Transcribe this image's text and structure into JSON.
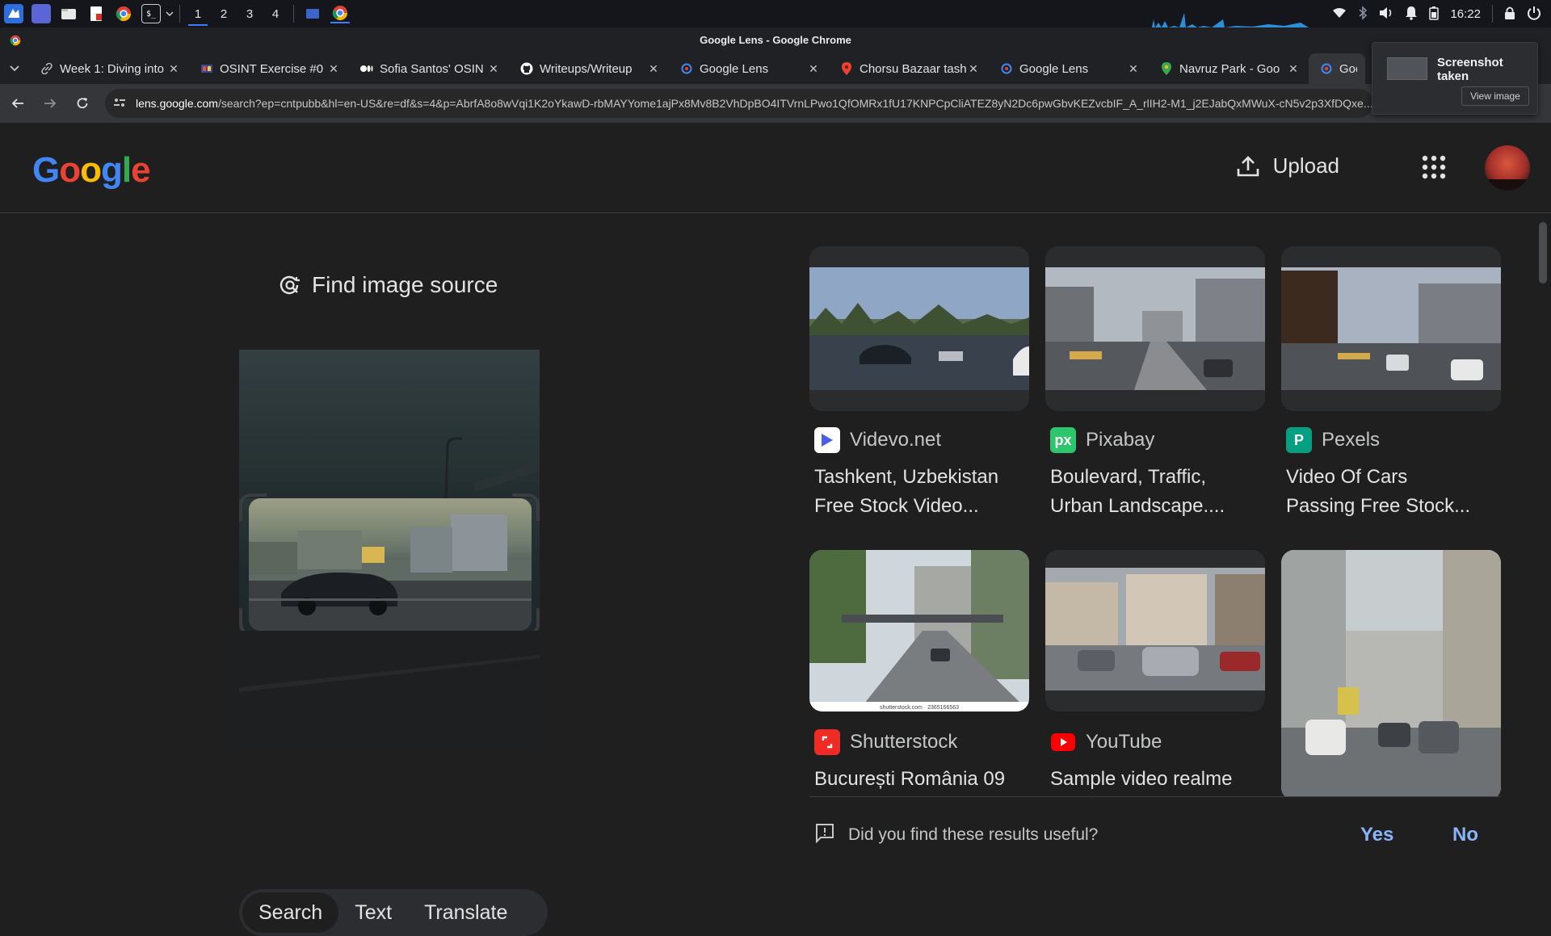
{
  "taskbar": {
    "workspaces": [
      "1",
      "2",
      "3",
      "4"
    ],
    "clock": "16:22"
  },
  "window": {
    "title": "Google Lens - Google Chrome"
  },
  "tabs": [
    {
      "label": "Week 1: Diving into",
      "icon": "link-icon"
    },
    {
      "label": "OSINT Exercise #0",
      "icon": "osint-favicon"
    },
    {
      "label": "Sofia Santos' OSIN",
      "icon": "medium-favicon"
    },
    {
      "label": "Writeups/Writeup",
      "icon": "github-favicon"
    },
    {
      "label": "Google Lens",
      "icon": "lens-favicon"
    },
    {
      "label": "Chorsu Bazaar tash",
      "icon": "maps-pin-favicon"
    },
    {
      "label": "Google Lens",
      "icon": "lens-favicon"
    },
    {
      "label": "Navruz Park - Goo",
      "icon": "maps-pin-favicon"
    },
    {
      "label": "Goog",
      "icon": "lens-favicon",
      "active": true
    }
  ],
  "address_bar": {
    "host": "lens.google.com",
    "path": "/search?ep=cntpubb&hl=en-US&re=df&s=4&p=AbrfA8o8wVqi1K2oYkawD-rbMAYYome1ajPx8Mv8B2VhDpBO4ITVrnLPwo1QfOMRx1fU17KNPCpCliATEZ8yN2Dc6pwGbvKEZvcbIF_A_rlIH2-M1_j2EJabQxMWuX-cN5v2p3XfDQxe..."
  },
  "notification": {
    "title": "Screenshot taken",
    "button": "View image"
  },
  "header": {
    "logo": "Google",
    "upload_label": "Upload"
  },
  "lens": {
    "find_source_label": "Find image source",
    "modes": [
      "Search",
      "Text",
      "Translate"
    ],
    "active_mode": "Search"
  },
  "results": [
    {
      "source": "Videvo.net",
      "title_line1": "Tashkent, Uzbekistan",
      "title_line2": "Free Stock Video...",
      "source_color": "#4c5ee8"
    },
    {
      "source": "Pixabay",
      "title_line1": "Boulevard, Traffic,",
      "title_line2": "Urban Landscape....",
      "source_color": "#2ec66d"
    },
    {
      "source": "Pexels",
      "title_line1": "Video Of Cars",
      "title_line2": "Passing Free Stock...",
      "source_color": "#05a081"
    },
    {
      "source": "Shutterstock",
      "title_line1": "București România 09",
      "title_line2": "",
      "source_color": "#ee2b24"
    },
    {
      "source": "YouTube",
      "title_line1": "Sample video realme",
      "title_line2": "",
      "source_color": "#ff0000"
    },
    {
      "source": "",
      "title_line1": "",
      "title_line2": "",
      "source_color": "#666666"
    }
  ],
  "image_captions": {
    "shutterstock_watermark": "shutterstock.com · 2365166563"
  },
  "feedback": {
    "question": "Did you find these results useful?",
    "yes": "Yes",
    "no": "No"
  }
}
